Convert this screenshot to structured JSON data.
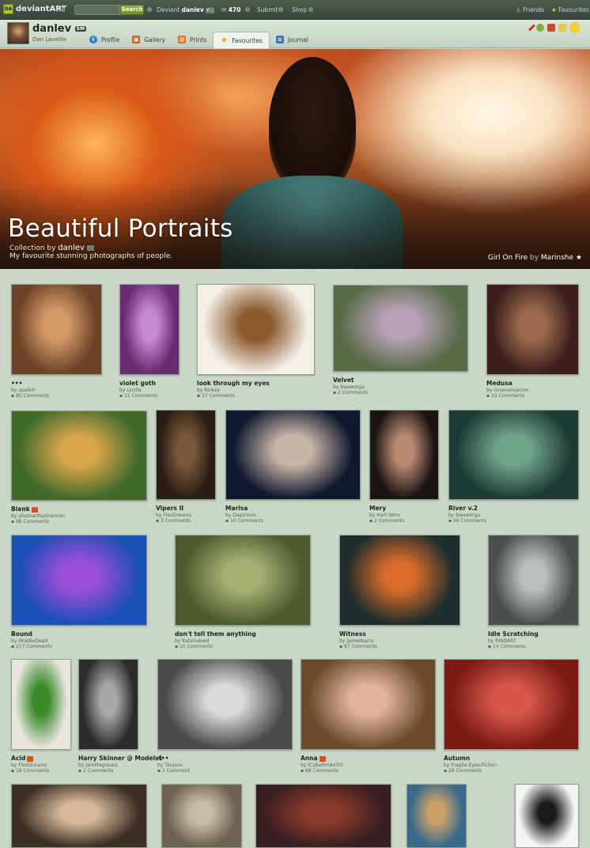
{
  "topbar": {
    "logo_badge": "DA",
    "logo_text": "deviantART",
    "search_placeholder": "",
    "search_button": "Search",
    "deviant_label": "Deviant",
    "deviant_user": "danlev",
    "deviant_badge": "PM",
    "notifications": "470",
    "submit": "Submit",
    "shop": "Shop",
    "friends": "Friends",
    "favourites": "Favourites"
  },
  "profile": {
    "username": "danlev",
    "badge": "SM",
    "real_name": "Dan Leveille",
    "tabs": [
      {
        "label": "Profile",
        "icon": "info-icon"
      },
      {
        "label": "Gallery",
        "icon": "gallery-icon"
      },
      {
        "label": "Prints",
        "icon": "prints-icon"
      },
      {
        "label": "Favourites",
        "icon": "star-icon"
      },
      {
        "label": "Journal",
        "icon": "journal-icon"
      }
    ]
  },
  "banner": {
    "title": "Beautiful Portraits",
    "collection_by": "Collection by",
    "owner": "danlev",
    "description": "My favourite stunning photographs of people.",
    "credit_title": "Girl On Fire",
    "credit_by": "by",
    "credit_artist": "Marinshe",
    "credit_star": "★"
  },
  "gallery": [
    {
      "title": "•••",
      "author": "apalkin",
      "comments": "85 Comments",
      "colors": [
        "#6b4326",
        "#d49a6a"
      ]
    },
    {
      "title": "violet goth",
      "author": "LycIlla",
      "comments": "11 Comments",
      "colors": [
        "#6a2a6e",
        "#c58bd1"
      ]
    },
    {
      "title": "look through my eyes",
      "author": "Rinksy",
      "comments": "17 Comments",
      "colors": [
        "#f3eee6",
        "#8a5a2e"
      ]
    },
    {
      "title": "Velvet",
      "author": "bwaworga",
      "comments": "2 Comments",
      "colors": [
        "#5a6b4a",
        "#b7a2b7"
      ]
    },
    {
      "title": "Medusa",
      "author": "Grooveinjector",
      "comments": "13 Comments",
      "colors": [
        "#3b1f1c",
        "#9b6a4c"
      ]
    },
    {
      "title": "Blank",
      "author": "photoartbyshannon",
      "comments": "86 Comments",
      "colors": [
        "#3f6a2b",
        "#d8a64a"
      ]
    },
    {
      "title": "Vipers II",
      "author": "FlexDreams",
      "comments": "3 Comments",
      "colors": [
        "#2a1d14",
        "#7a5a3a"
      ]
    },
    {
      "title": "Marisa",
      "author": "Dapicture",
      "comments": "10 Comments",
      "colors": [
        "#10182e",
        "#c9b6a8"
      ]
    },
    {
      "title": "Mery",
      "author": "Hart-Worx",
      "comments": "2 Comments",
      "colors": [
        "#1a1412",
        "#b98a72"
      ]
    },
    {
      "title": "River v.2",
      "author": "bwaworga",
      "comments": "66 Comments",
      "colors": [
        "#1e3a34",
        "#6fa38a"
      ]
    },
    {
      "title": "Bound",
      "author": "IIKatBeDead",
      "comments": "217 Comments",
      "colors": [
        "#1a4fb8",
        "#9b4fd6"
      ]
    },
    {
      "title": "don't tell them anything",
      "author": "KateIndeed",
      "comments": "15 Comments",
      "colors": [
        "#4c5a2e",
        "#a6b072"
      ]
    },
    {
      "title": "Witness",
      "author": "JaimeIbarra",
      "comments": "87 Comments",
      "colors": [
        "#1f2d2c",
        "#d66b2a"
      ]
    },
    {
      "title": "Idle Scratching",
      "author": "RiNDART",
      "comments": "14 Comments",
      "colors": [
        "#4a4e4c",
        "#b9bfbc"
      ]
    },
    {
      "title": "Acid",
      "author": "FlexDreams",
      "comments": "18 Comments",
      "colors": [
        "#e9e6e0",
        "#3a8a2a"
      ]
    },
    {
      "title": "Harry Skinner @ Models1",
      "author": "jamillegraves",
      "comments": "2 Comments",
      "colors": [
        "#2b2b2b",
        "#a9a9a9"
      ]
    },
    {
      "title": "•••",
      "author": "Tarasov",
      "comments": "1 Comment",
      "colors": [
        "#4a4a4a",
        "#dadada"
      ]
    },
    {
      "title": "Anna",
      "author": "ICyBeRmAnTIS",
      "comments": "68 Comments",
      "colors": [
        "#6a4a2a",
        "#e0b49a"
      ]
    },
    {
      "title": "Autumn",
      "author": "Fragile-Eyes-Fiction",
      "comments": "29 Comments",
      "colors": [
        "#7a1a14",
        "#d6584a"
      ]
    },
    {
      "title": "",
      "author": "",
      "comments": "",
      "colors": [
        "#3c3024",
        "#d7b99a"
      ]
    },
    {
      "title": "",
      "author": "",
      "comments": "",
      "colors": [
        "#6d6250",
        "#c7bca5"
      ]
    },
    {
      "title": "",
      "author": "",
      "comments": "",
      "colors": [
        "#3a1f22",
        "#8a3a2a"
      ]
    },
    {
      "title": "",
      "author": "",
      "comments": "",
      "colors": [
        "#3a6a8a",
        "#c9a16a"
      ]
    },
    {
      "title": "",
      "author": "",
      "comments": "",
      "colors": [
        "#f4f4f4",
        "#1a1a1a"
      ]
    }
  ]
}
